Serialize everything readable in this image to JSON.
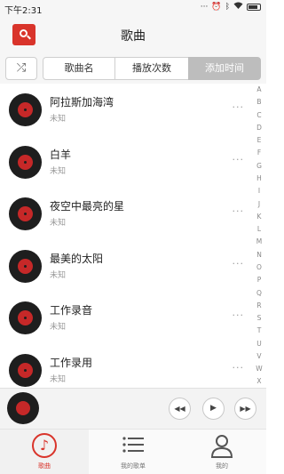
{
  "status_bar": {
    "time": "下午2:31",
    "icons": [
      "dots-icon",
      "alarm-icon",
      "bluetooth-icon",
      "wifi-icon",
      "battery-icon"
    ]
  },
  "header": {
    "title": "歌曲",
    "logo_icon": "folder-search-icon",
    "accent_color": "#d9342b"
  },
  "sort_bar": {
    "shuffle_icon": "shuffle-icon",
    "tabs": [
      {
        "label": "歌曲名",
        "active": false
      },
      {
        "label": "播放次数",
        "active": false
      },
      {
        "label": "添加时间",
        "active": true
      }
    ]
  },
  "songs": [
    {
      "title": "阿拉斯加海湾",
      "artist": "未知",
      "more": "···"
    },
    {
      "title": "白羊",
      "artist": "未知",
      "more": "···"
    },
    {
      "title": "夜空中最亮的星",
      "artist": "未知",
      "more": "···"
    },
    {
      "title": "最美的太阳",
      "artist": "未知",
      "more": "···"
    },
    {
      "title": "工作录音",
      "artist": "未知",
      "more": "···"
    },
    {
      "title": "工作录用",
      "artist": "未知",
      "more": "···"
    }
  ],
  "index_letters": [
    "A",
    "B",
    "C",
    "D",
    "E",
    "F",
    "G",
    "H",
    "I",
    "J",
    "K",
    "L",
    "M",
    "N",
    "O",
    "P",
    "Q",
    "R",
    "S",
    "T",
    "U",
    "V",
    "W",
    "X"
  ],
  "player": {
    "prev": "◀◀",
    "play": "▶",
    "next": "▶▶"
  },
  "bottom_nav": [
    {
      "label": "歌曲",
      "icon": "music-note-icon",
      "active": true
    },
    {
      "label": "我的歌单",
      "icon": "playlist-icon",
      "active": false
    },
    {
      "label": "我的",
      "icon": "user-icon",
      "active": false
    }
  ]
}
